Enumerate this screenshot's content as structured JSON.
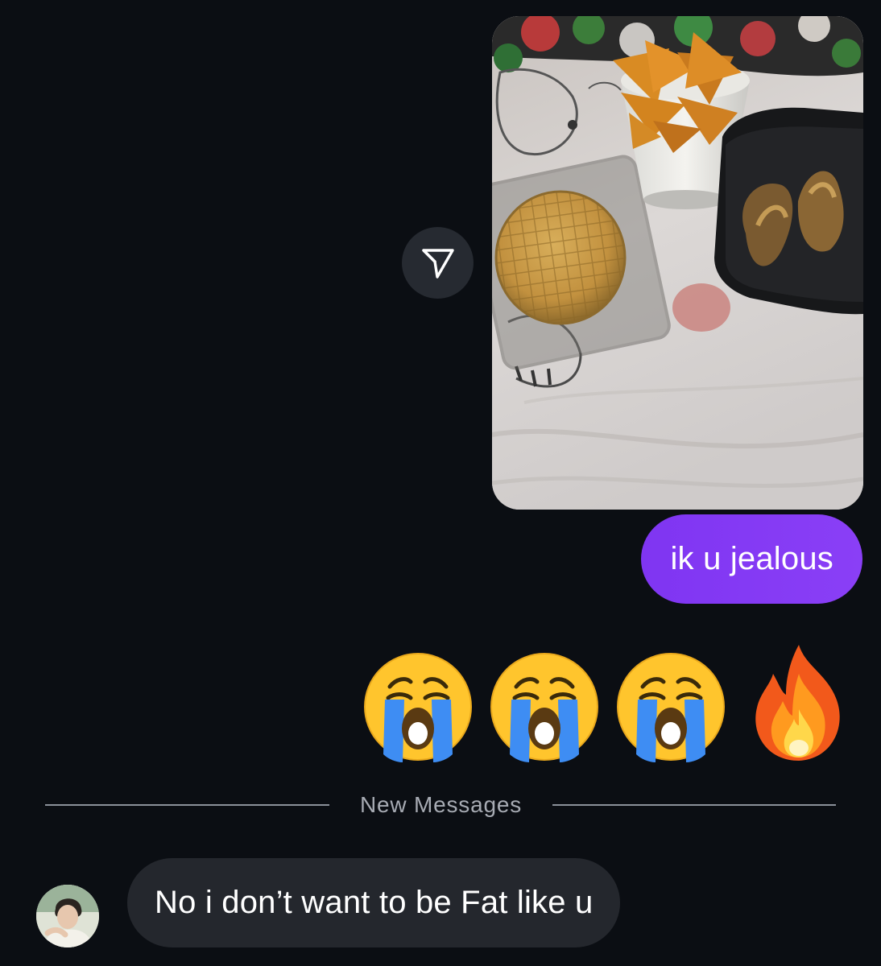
{
  "thread": {
    "outgoing_text": "ik u jealous",
    "reaction_emojis": [
      "😭",
      "😭",
      "😭",
      "🔥"
    ],
    "divider_label": "New Messages",
    "incoming_text": "No i don’t want to be Fat like u"
  },
  "icons": {
    "share": "paper-plane-icon",
    "emoji_cry": "loudly-crying-face-emoji",
    "emoji_fire": "fire-emoji"
  },
  "colors": {
    "background": "#0b0e13",
    "outgoing_bubble": "#8037f3",
    "incoming_bubble": "#24272d",
    "share_button": "#262a31",
    "divider": "#8b909a"
  }
}
